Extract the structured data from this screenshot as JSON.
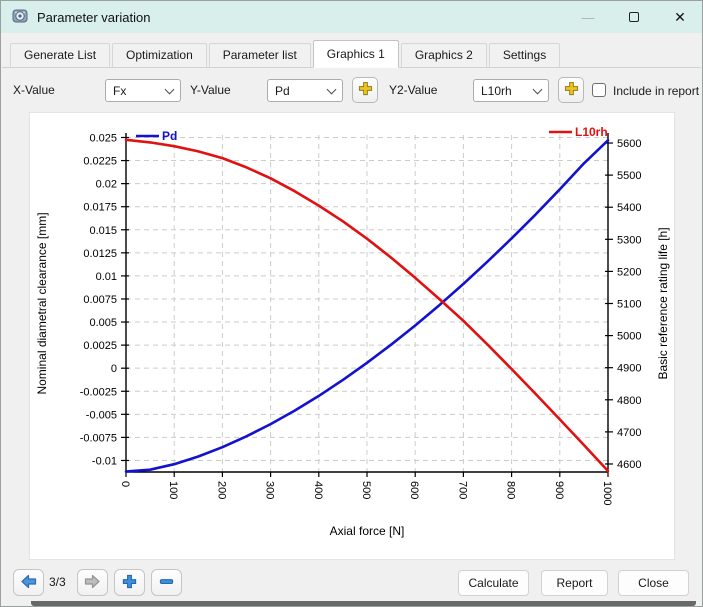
{
  "window": {
    "title": "Parameter variation",
    "controls": {
      "minimize": "—",
      "close": "✕"
    }
  },
  "tabs": [
    {
      "label": "Generate List",
      "active": false
    },
    {
      "label": "Optimization",
      "active": false
    },
    {
      "label": "Parameter list",
      "active": false
    },
    {
      "label": "Graphics 1",
      "active": true
    },
    {
      "label": "Graphics 2",
      "active": false
    },
    {
      "label": "Settings",
      "active": false
    }
  ],
  "toolbar": {
    "x_label": "X-Value",
    "x_value": "Fx",
    "y_label": "Y-Value",
    "y_value": "Pd",
    "y2_label": "Y2-Value",
    "y2_value": "L10rh",
    "include_label": "Include in report",
    "include_checked": false
  },
  "chart_data": {
    "type": "line",
    "xlabel": "Axial force [N]",
    "ylabel_left": "Nominal diametral clearance [mm]",
    "ylabel_right": "Basic reference rating life [h]",
    "xlim": [
      0,
      1000
    ],
    "xticks": [
      0,
      100,
      200,
      300,
      400,
      500,
      600,
      700,
      800,
      900,
      1000
    ],
    "ylim_left": [
      -0.01125,
      0.02527
    ],
    "yticks_left": [
      -0.01,
      -0.0075,
      -0.005,
      -0.0025,
      0,
      0.0025,
      0.005,
      0.0075,
      0.01,
      0.0125,
      0.015,
      0.0175,
      0.02,
      0.0225,
      0.025
    ],
    "ylim_right": [
      4575,
      5625
    ],
    "yticks_right": [
      4600,
      4700,
      4800,
      4900,
      5000,
      5100,
      5200,
      5300,
      5400,
      5500,
      5600
    ],
    "grid": true,
    "legend_position": "top-inside",
    "x": [
      0,
      50,
      100,
      150,
      200,
      250,
      300,
      350,
      400,
      450,
      500,
      550,
      600,
      650,
      700,
      750,
      800,
      850,
      900,
      950,
      1000
    ],
    "series": [
      {
        "name": "Pd",
        "axis": "left",
        "color": "#1212cf",
        "values": [
          -0.0112,
          -0.011,
          -0.0104,
          -0.00957,
          -0.00856,
          -0.00738,
          -0.00606,
          -0.0046,
          -0.003,
          -0.00127,
          0.00058,
          0.00255,
          0.00463,
          0.00683,
          0.00913,
          0.01155,
          0.01406,
          0.01667,
          0.01939,
          0.02219,
          0.0247
        ]
      },
      {
        "name": "L10rh",
        "axis": "right",
        "color": "#e01111",
        "values": [
          5610,
          5602,
          5590,
          5574,
          5553,
          5524,
          5490,
          5450,
          5405,
          5356,
          5302,
          5243,
          5180,
          5114,
          5046,
          4972,
          4896,
          4818,
          4739,
          4659,
          4578
        ]
      }
    ]
  },
  "footer": {
    "page": "3/3",
    "calculate_label": "Calculate",
    "report_label": "Report",
    "close_label": "Close"
  },
  "icons": {
    "app": "bearing-icon",
    "prev": "arrow-left-icon",
    "next": "arrow-right-icon",
    "add": "plus-icon",
    "remove": "minus-icon",
    "add_curve": "gold-plus-icon"
  },
  "colors": {
    "titlebar": "#d8efec",
    "dialog_bg": "#f0f0f0",
    "grid": "#cccccc",
    "series_pd": "#1212cf",
    "series_l10rh": "#e01111",
    "gold_plus": "#eec41c",
    "nav_blue": "#3f8fdf"
  }
}
